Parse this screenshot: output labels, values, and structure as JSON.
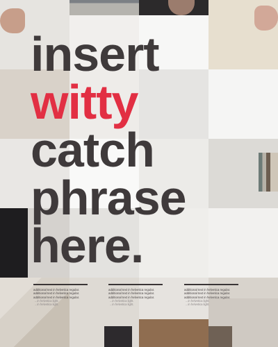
{
  "headline": {
    "line1": "insert",
    "line2": "witty",
    "line3": "catch",
    "line4": "phrase",
    "line5": "here."
  },
  "colors": {
    "headline": "#3f3a3b",
    "accent": "#e22f43",
    "poster_light": "#f4f4f2",
    "poster_mid": "#e8e7e4"
  },
  "footnotes": [
    {
      "line1": "additional text in helvetica regular.",
      "line2": "additional text in helvetica regular.",
      "line3": "additional text in helvetica regular.",
      "sub1": "...in helvetica light.",
      "sub2": "...in helvetica light."
    },
    {
      "line1": "additional text in helvetica regular.",
      "line2": "additional text in helvetica regular.",
      "line3": "additional text in helvetica regular.",
      "sub1": "...in helvetica light.",
      "sub2": "...in helvetica light."
    },
    {
      "line1": "additional text in helvetica regular.",
      "line2": "additional text in helvetica regular.",
      "line3": "additional text in helvetica regular.",
      "sub1": "...in helvetica light.",
      "sub2": "...in helvetica light."
    }
  ]
}
